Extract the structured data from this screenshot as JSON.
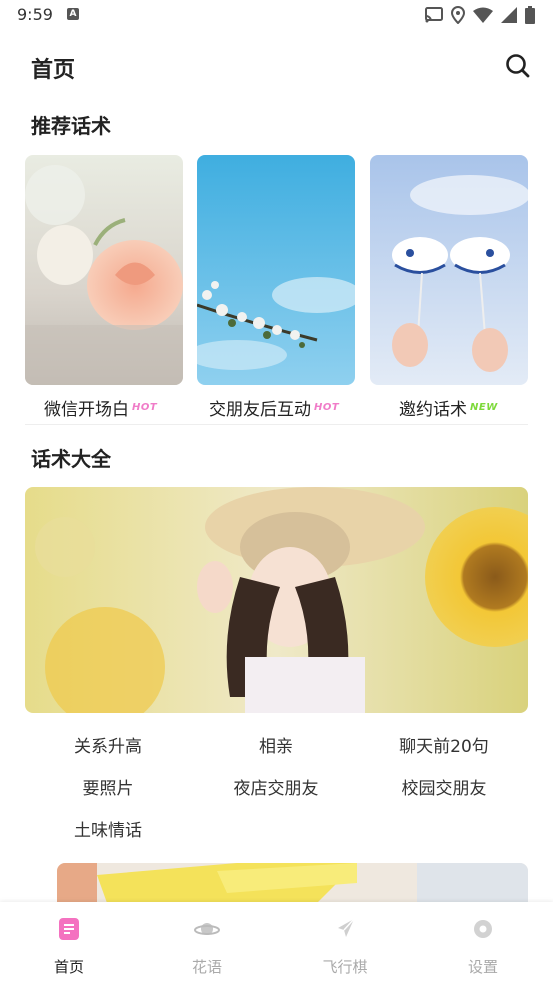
{
  "status_bar": {
    "time": "9:59",
    "a_icon": "A"
  },
  "header": {
    "title": "首页",
    "search_icon": "search-icon"
  },
  "recommend": {
    "title": "推荐话术",
    "cards": [
      {
        "label": "微信开场白",
        "badge": "HOT",
        "badge_color": "#f07cc8"
      },
      {
        "label": "交朋友后互动",
        "badge": "HOT",
        "badge_color": "#f07cc8"
      },
      {
        "label": "邀约话术",
        "badge": "NEW",
        "badge_color": "#7dd93a"
      }
    ]
  },
  "all_topics": {
    "title": "话术大全",
    "items": [
      "关系升高",
      "相亲",
      "聊天前20句",
      "要照片",
      "夜店交朋友",
      "校园交朋友",
      "土味情话"
    ]
  },
  "bottom_nav": {
    "items": [
      {
        "label": "首页",
        "icon": "note-icon",
        "active": true
      },
      {
        "label": "花语",
        "icon": "planet-icon",
        "active": false
      },
      {
        "label": "飞行棋",
        "icon": "plane-icon",
        "active": false
      },
      {
        "label": "设置",
        "icon": "gear-icon",
        "active": false
      }
    ]
  },
  "colors": {
    "accent_pink": "#f07cc8",
    "new_green": "#7dd93a",
    "text_dark": "#222222",
    "text_muted": "#aaaaaa"
  }
}
